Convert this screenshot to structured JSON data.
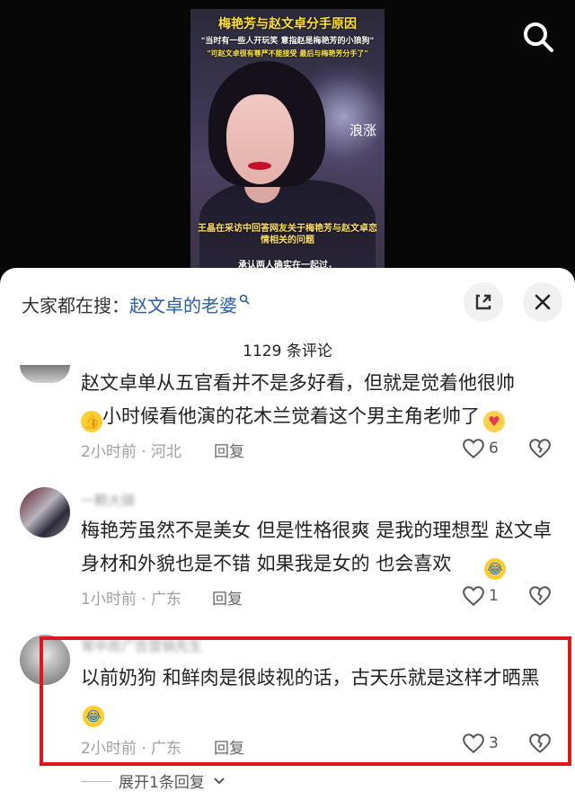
{
  "video": {
    "title_main": "梅艳芳与赵文卓分手原因",
    "title_quote": "\"当时有一些人开玩笑 意指赵是梅艳芳的小狼狗\"",
    "title_sub": "\"可赵文卓很有尊严不能接受 最后与梅艳芳分手了\"",
    "watermark": "浪涨",
    "caption_main": "王晶在采访中回答网友关于梅艳芳与赵文卓恋情相关的问题",
    "caption_sub": "承认两人确实在一起过，"
  },
  "sheet": {
    "hot_search_prefix": "大家都在搜：",
    "hot_search_term": "赵文卓的老婆",
    "comment_count": "1129 条评论"
  },
  "comments": [
    {
      "text_line1": "赵文卓单从五官看并不是多好看，但就是觉着他很帅",
      "text_line2": "小时候看他演的花木兰觉着这个男主角老帅了",
      "time_location": "2小时前 · 河北",
      "reply": "回复",
      "likes": "6"
    },
    {
      "username": "一颗大頭",
      "text": "梅艳芳虽然不是美女 但是性格很爽 是我的理想型 赵文卓身材和外貌也是不错 如果我是女的 也会喜欢",
      "time_location": "1小时前 · 广东",
      "reply": "回复",
      "likes": "1"
    },
    {
      "username": "常中房广告营销先生",
      "text": "以前奶狗 和鲜肉是很歧视的话，古天乐就是这样才晒黑",
      "time_location": "2小时前 · 广东",
      "reply": "回复",
      "likes": "3"
    }
  ],
  "expand_replies": "展开1条回复",
  "colors": {
    "highlight": "#e0161f",
    "link": "#2a5caa"
  },
  "icons": [
    "search-icon",
    "expand-icon",
    "close-icon",
    "heart-icon",
    "broken-heart-icon",
    "chevron-down-icon"
  ]
}
